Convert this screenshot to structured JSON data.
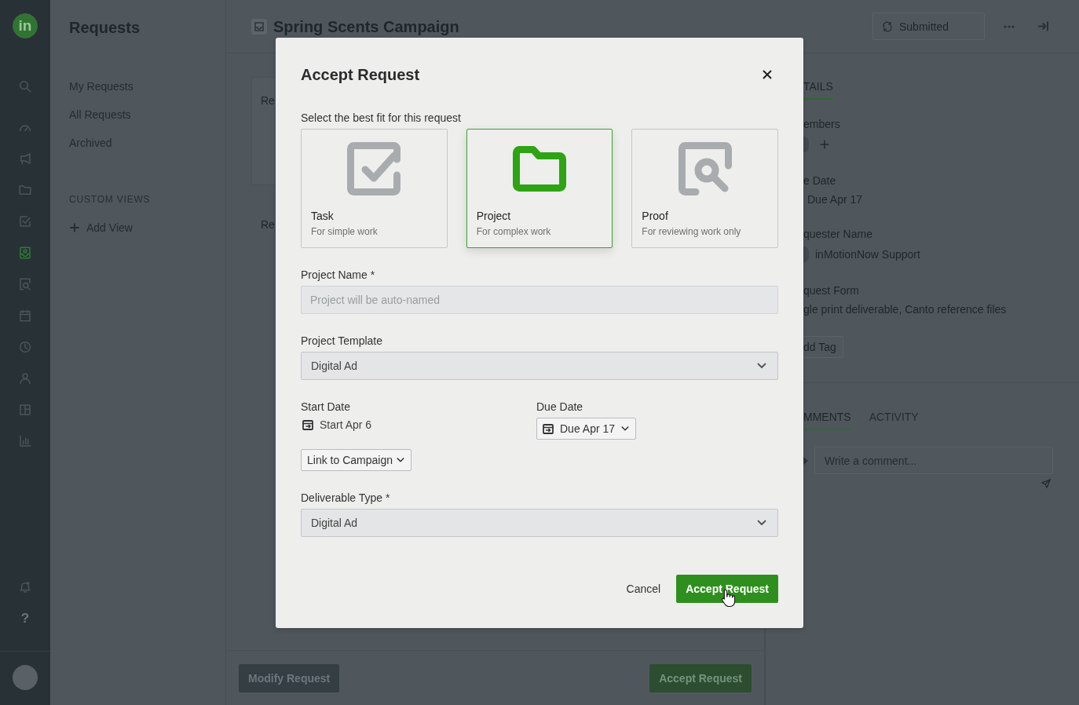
{
  "nav_rail": {
    "logo": "in",
    "items": [
      {
        "kind": "search",
        "selected": false
      },
      {
        "kind": "dashboard",
        "selected": false
      },
      {
        "kind": "campaigns",
        "selected": false
      },
      {
        "kind": "projects",
        "selected": false
      },
      {
        "kind": "tasks",
        "selected": false
      },
      {
        "kind": "requests",
        "selected": true
      },
      {
        "kind": "proofs",
        "selected": false
      },
      {
        "kind": "calendar",
        "selected": false
      },
      {
        "kind": "time",
        "selected": false
      },
      {
        "kind": "people",
        "selected": false
      },
      {
        "kind": "boards",
        "selected": false
      },
      {
        "kind": "reports",
        "selected": false
      }
    ],
    "bottom_items": [
      {
        "kind": "notifications"
      },
      {
        "kind": "help",
        "glyph": "?"
      }
    ]
  },
  "requests_panel": {
    "title": "Requests",
    "items": [
      {
        "label": "My Requests",
        "selected": false
      },
      {
        "label": "All Requests",
        "selected": false
      },
      {
        "label": "Archived",
        "selected": false
      }
    ],
    "section_title": "CUSTOM VIEWS",
    "add_view": "Add View"
  },
  "header": {
    "title": "Spring Scents Campaign",
    "status": "Submitted"
  },
  "request_body": {
    "card_heading": "Re",
    "field_label": "Re"
  },
  "details_panel": {
    "tabs": [
      {
        "label": "TAILS",
        "selected": true
      }
    ],
    "members_label": "embers",
    "due_date_label": "e Date",
    "due_date": "Due Apr 17",
    "requester_label": "quester Name",
    "requester": "inMotionNow Support",
    "form_label": "quest Form",
    "form_value": "gle print deliverable, Canto reference files",
    "tag_button": "dd Tag"
  },
  "activity_panel": {
    "tabs": [
      {
        "label": "MMENTS",
        "selected": true
      },
      {
        "label": "ACTIVITY",
        "selected": false
      }
    ],
    "comment": {
      "placeholder": "Write a comment..."
    }
  },
  "footer": {
    "buttons": [
      {
        "label": "Modify Request",
        "kind": "secondary"
      },
      {
        "label": "Accept Request",
        "kind": "primary"
      }
    ]
  },
  "modal": {
    "title": "Accept Request",
    "prompt": "Select the best fit for this request",
    "types": [
      {
        "kind": "task",
        "label": "Task",
        "description": "For simple work",
        "selected": false
      },
      {
        "kind": "project",
        "label": "Project",
        "description": "For complex work",
        "selected": true
      },
      {
        "kind": "proof",
        "label": "Proof",
        "description": "For reviewing work only",
        "selected": false
      }
    ],
    "project_name": {
      "label": "Project Name *",
      "placeholder": "Project will be auto-named"
    },
    "project_template": {
      "label": "Project Template",
      "value": "Digital Ad"
    },
    "start_date": {
      "label": "Start Date",
      "value": "Start Apr 6"
    },
    "due_date": {
      "label": "Due Date",
      "value": "Due Apr 17"
    },
    "campaign_link": {
      "label": "Link to Campaign"
    },
    "deliverable_type": {
      "label": "Deliverable Type *",
      "value": "Digital Ad"
    },
    "actions": [
      {
        "label": "Cancel",
        "kind": "link"
      },
      {
        "label": "Accept Request",
        "kind": "primary"
      }
    ]
  }
}
